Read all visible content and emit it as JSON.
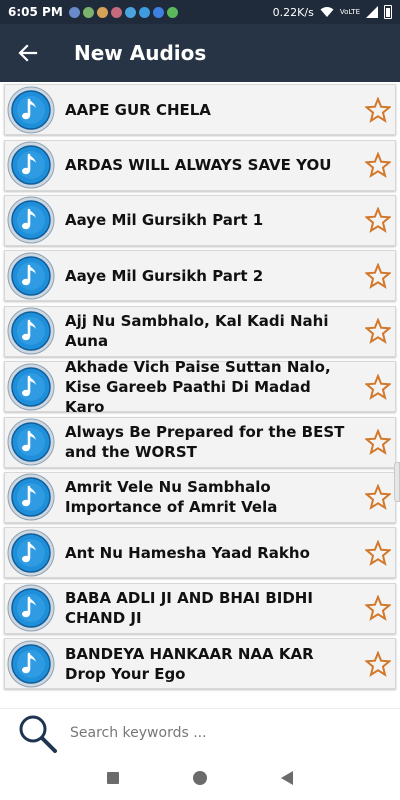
{
  "status_bar": {
    "time": "6:05 PM",
    "network_speed": "0.22K/s",
    "network_type": "VoLTE",
    "icons": [
      "notification-icon",
      "wifi-icon",
      "signal-icon",
      "battery-icon"
    ]
  },
  "app_bar": {
    "title": "New Audios",
    "back_icon": "arrow-back-icon"
  },
  "audios": [
    {
      "title": "AAPE GUR CHELA"
    },
    {
      "title": "ARDAS WILL ALWAYS SAVE YOU"
    },
    {
      "title": "Aaye Mil Gursikh Part 1"
    },
    {
      "title": "Aaye Mil Gursikh Part 2"
    },
    {
      "title": "Ajj Nu Sambhalo, Kal Kadi Nahi Auna"
    },
    {
      "title": "Akhade Vich Paise Suttan Nalo, Kise Gareeb Paathi Di Madad Karo"
    },
    {
      "title": "Always Be Prepared for the BEST and the WORST"
    },
    {
      "title": "Amrit Vele Nu Sambhalo Importance of Amrit Vela"
    },
    {
      "title": "Ant Nu Hamesha Yaad Rakho"
    },
    {
      "title": "BABA ADLI JI AND BHAI BIDHI CHAND JI"
    },
    {
      "title": "BANDEYA HANKAAR NAA KAR Drop Your Ego"
    }
  ],
  "search": {
    "placeholder": "Search keywords ..."
  },
  "colors": {
    "app_bar": "#263445",
    "star": "#d2782a",
    "disc": "#1f8fd9"
  }
}
